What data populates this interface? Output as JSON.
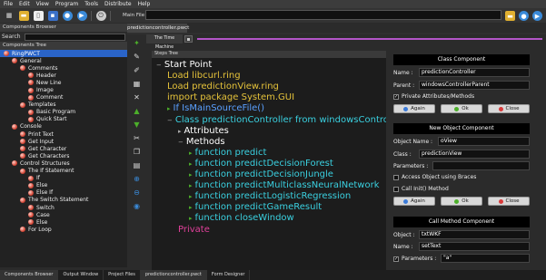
{
  "menu": [
    "File",
    "Edit",
    "View",
    "Program",
    "Tools",
    "Distribute",
    "Help"
  ],
  "mainfile": {
    "label": "Main File :"
  },
  "left": {
    "title": "Components Browser",
    "search_label": "Search",
    "tree_title": "Components Tree",
    "tree": [
      {
        "label": "RingPWCT",
        "level": 0,
        "selected": true,
        "root": true
      },
      {
        "label": "General",
        "level": 1
      },
      {
        "label": "Comments",
        "level": 2
      },
      {
        "label": "Header",
        "level": 3
      },
      {
        "label": "New Line",
        "level": 3
      },
      {
        "label": "Image",
        "level": 3
      },
      {
        "label": "Comment",
        "level": 3
      },
      {
        "label": "Templates",
        "level": 2
      },
      {
        "label": "Basic Program",
        "level": 3
      },
      {
        "label": "Quick Start",
        "level": 3
      },
      {
        "label": "Console",
        "level": 1
      },
      {
        "label": "Print Text",
        "level": 2
      },
      {
        "label": "Get Input",
        "level": 2
      },
      {
        "label": "Get Character",
        "level": 2
      },
      {
        "label": "Get Characters",
        "level": 2
      },
      {
        "label": "Control Structures",
        "level": 1
      },
      {
        "label": "The If Statement",
        "level": 2
      },
      {
        "label": "If",
        "level": 3
      },
      {
        "label": "Else",
        "level": 3
      },
      {
        "label": "Else If",
        "level": 3
      },
      {
        "label": "The Switch Statement",
        "level": 2
      },
      {
        "label": "Switch",
        "level": 3
      },
      {
        "label": "Case",
        "level": 3
      },
      {
        "label": "Else",
        "level": 3
      },
      {
        "label": "For Loop",
        "level": 2
      }
    ]
  },
  "bottom_tabs": [
    "Components Browser",
    "Output Window",
    "Project Files",
    "predictioncontroller.pwct",
    "Form Designer"
  ],
  "doc_tab": "predictioncontroller.pwct",
  "time_machine_tab": "The Time Machine",
  "steps": {
    "title": "Steps Tree",
    "lines": [
      {
        "text": "Start Point",
        "color": "#ffffff",
        "indent": 0,
        "arrow": "minus"
      },
      {
        "text": "Load libcurl.ring",
        "color": "#e5c23a",
        "indent": 1,
        "arrow": "none"
      },
      {
        "text": "Load predictionView.ring",
        "color": "#e5c23a",
        "indent": 1,
        "arrow": "none"
      },
      {
        "text": "import package System.GUI",
        "color": "#e5c23a",
        "indent": 1,
        "arrow": "none"
      },
      {
        "text": "If IsMainSourceFile()",
        "color": "#5aa0ff",
        "indent": 1,
        "arrow": "right"
      },
      {
        "text": "Class predictionController from windowsController",
        "color": "#3ad0e0",
        "indent": 1,
        "arrow": "minus"
      },
      {
        "text": "Attributes",
        "color": "#ffffff",
        "indent": 2,
        "arrow": "right"
      },
      {
        "text": "Methods",
        "color": "#ffffff",
        "indent": 2,
        "arrow": "minus"
      },
      {
        "text": "function predict",
        "color": "#3ad0e0",
        "indent": 3,
        "arrow": "right"
      },
      {
        "text": "function predictDecisionForest",
        "color": "#3ad0e0",
        "indent": 3,
        "arrow": "right"
      },
      {
        "text": "function predictDecisionJungle",
        "color": "#3ad0e0",
        "indent": 3,
        "arrow": "right"
      },
      {
        "text": "function predictMulticlassNeuralNetwork",
        "color": "#3ad0e0",
        "indent": 3,
        "arrow": "right"
      },
      {
        "text": "function predictLogisticRegression",
        "color": "#3ad0e0",
        "indent": 3,
        "arrow": "right"
      },
      {
        "text": "function predictGameResult",
        "color": "#3ad0e0",
        "indent": 3,
        "arrow": "right"
      },
      {
        "text": "function closeWindow",
        "color": "#3ad0e0",
        "indent": 3,
        "arrow": "right"
      },
      {
        "text": "Private",
        "color": "#e0409a",
        "indent": 2,
        "arrow": "none"
      }
    ]
  },
  "class_comp": {
    "title": "Class Component",
    "name_label": "Name :",
    "name_value": "predictionController",
    "parent_label": "Parent :",
    "parent_value": "windowsControllerParent",
    "private_label": "Private Attributes/Methods",
    "private_checked": true
  },
  "new_obj": {
    "title": "New Object Component",
    "objname_label": "Object Name :",
    "objname_value": "oView",
    "class_label": "Class :",
    "class_value": "predictionView",
    "params_label": "Parameters :",
    "params_value": "",
    "braces_label": "Access Object using Braces",
    "init_label": "Call Init() Method"
  },
  "call_method": {
    "title": "Call Method Component",
    "object_label": "Object :",
    "object_value": "txtWKF",
    "name_label": "Name :",
    "name_value": "setText",
    "params_label": "Parameters :",
    "params_value": "\"a\""
  },
  "buttons": {
    "again": "Again",
    "ok": "Ok",
    "close": "Close"
  },
  "colors": {
    "again": "#3a7ad8",
    "ok": "#4caf2a",
    "close": "#d83a3a",
    "slider": "#b455c8"
  }
}
